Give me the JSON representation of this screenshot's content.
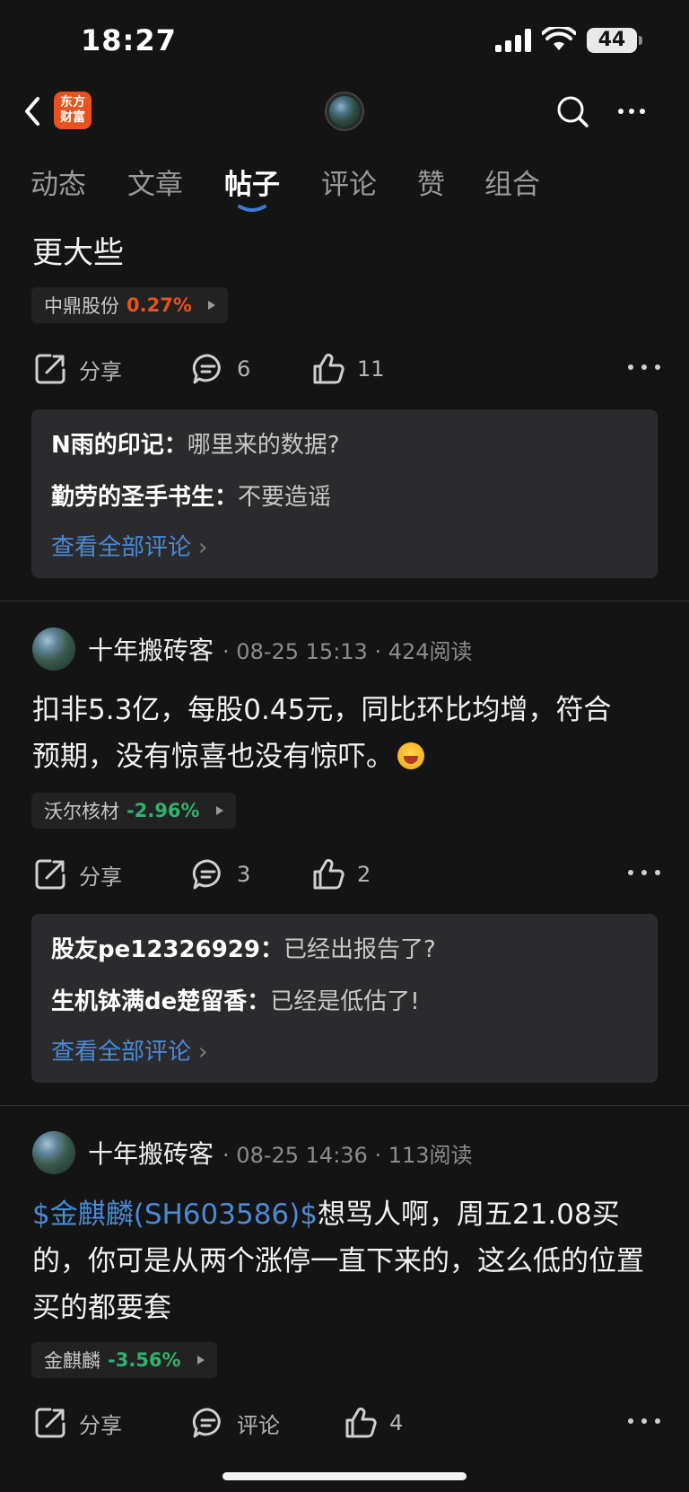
{
  "status_bar": {
    "time": "18:27",
    "battery": "44"
  },
  "nav": {
    "logo_line1": "东方",
    "logo_line2": "财富"
  },
  "tabs": [
    {
      "label": "动态"
    },
    {
      "label": "文章"
    },
    {
      "label": "帖子",
      "active": true
    },
    {
      "label": "评论"
    },
    {
      "label": "赞"
    },
    {
      "label": "组合"
    }
  ],
  "colors": {
    "up": "#e8521f",
    "down": "#2fb36f",
    "link": "#4a8ad6",
    "accent": "#3b7bd6"
  },
  "posts": [
    {
      "body_tail": "更大些",
      "stock": {
        "name": "中鼎股份",
        "change": "0.27%"
      },
      "actions": {
        "share": "分享",
        "comments": "6",
        "likes": "11"
      },
      "comments": [
        {
          "user": "N雨的印记：",
          "text": "哪里来的数据?"
        },
        {
          "user": "勤劳的圣手书生：",
          "text": "不要造谣"
        }
      ],
      "see_all": "查看全部评论"
    },
    {
      "author": "十年搬砖客",
      "date": "08-25 15:13",
      "reads": "424阅读",
      "body": "扣非5.3亿，每股0.45元，同比环比均增，符合预期，没有惊喜也没有惊吓。",
      "emoji": "laughing-face",
      "stock": {
        "name": "沃尔核材",
        "change": "-2.96%"
      },
      "actions": {
        "share": "分享",
        "comments": "3",
        "likes": "2"
      },
      "comments": [
        {
          "user": "股友pe12326929：",
          "text": "已经出报告了?"
        },
        {
          "user": "生机钵满de楚留香：",
          "text": "已经是低估了!"
        }
      ],
      "see_all": "查看全部评论"
    },
    {
      "author": "十年搬砖客",
      "date": "08-25 14:36",
      "reads": "113阅读",
      "cashtag": "$金麒麟(SH603586)$",
      "body": "想骂人啊，周五21.08买的，你可是从两个涨停一直下来的，这么低的位置买的都要套",
      "stock": {
        "name": "金麒麟",
        "change": "-3.56%"
      },
      "actions": {
        "share": "分享",
        "comment": "评论",
        "likes": "4"
      }
    }
  ],
  "separator": "·"
}
